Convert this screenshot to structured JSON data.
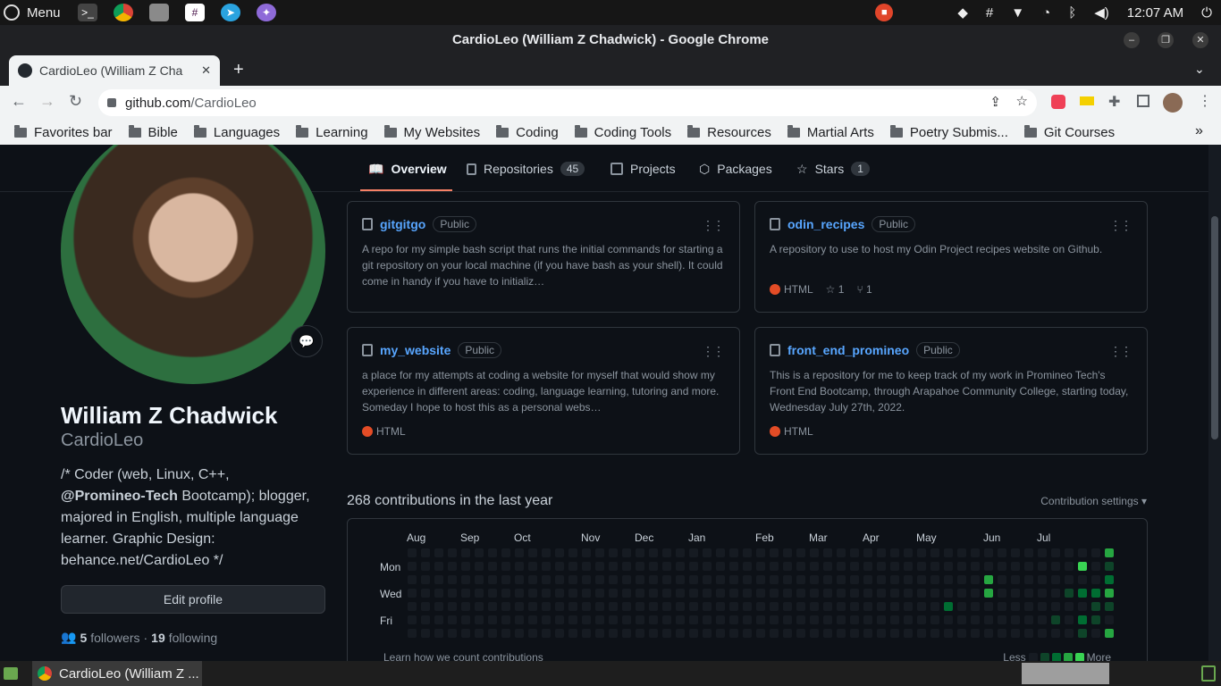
{
  "os_panel": {
    "menu_label": "Menu",
    "clock": "12:07 AM"
  },
  "window": {
    "title": "CardioLeo (William Z Chadwick) - Google Chrome"
  },
  "tab": {
    "title": "CardioLeo (William Z Cha"
  },
  "omnibox": {
    "host": "github.com",
    "path": "/CardioLeo"
  },
  "bookmarks": [
    "Favorites bar",
    "Bible",
    "Languages",
    "Learning",
    "My Websites",
    "Coding",
    "Coding Tools",
    "Resources",
    "Martial Arts",
    "Poetry Submis...",
    "Git Courses"
  ],
  "gh_tabs": {
    "overview": "Overview",
    "repositories": "Repositories",
    "repositories_count": "45",
    "projects": "Projects",
    "packages": "Packages",
    "stars": "Stars",
    "stars_count": "1"
  },
  "profile": {
    "name": "William Z Chadwick",
    "login": "CardioLeo",
    "bio_1": "/* Coder (web, Linux, C++,",
    "bio_org": "@Promineo-Tech",
    "bio_2": " Bootcamp); blogger, majored in English, multiple language learner. Graphic Design: behance.net/CardioLeo */",
    "edit_label": "Edit profile",
    "followers": "5",
    "followers_label": "followers",
    "dot": "·",
    "following": "19",
    "following_label": "following"
  },
  "repos": [
    {
      "name": "gitgitgo",
      "visibility": "Public",
      "description": "A repo for my simple bash script that runs the initial commands for starting a git repository on your local machine (if you have bash as your shell). It could come in handy if you have to initializ…"
    },
    {
      "name": "odin_recipes",
      "visibility": "Public",
      "description": "A repository to use to host my Odin Project recipes website on Github.",
      "language": "HTML",
      "stars": "1",
      "forks": "1"
    },
    {
      "name": "my_website",
      "visibility": "Public",
      "description": "a place for my attempts at coding a website for myself that would show my experience in different areas: coding, language learning, tutoring and more. Someday I hope to host this as a personal webs…",
      "language": "HTML"
    },
    {
      "name": "front_end_promineo",
      "visibility": "Public",
      "description": "This is a repository for me to keep track of my work in Promineo Tech's Front End Bootcamp, through Arapahoe Community College, starting today, Wednesday July 27th, 2022.",
      "language": "HTML"
    }
  ],
  "contributions": {
    "title": "268 contributions in the last year",
    "settings": "Contribution settings ▾",
    "months": [
      "Aug",
      "Sep",
      "Oct",
      "Nov",
      "Dec",
      "Jan",
      "Feb",
      "Mar",
      "Apr",
      "May",
      "Jun",
      "Jul"
    ],
    "days": [
      "Mon",
      "Wed",
      "Fri"
    ],
    "learn": "Learn how we count contributions",
    "less": "Less",
    "more": "More",
    "colors": [
      "#161b22",
      "#0e4429",
      "#006d32",
      "#26a641",
      "#39d353"
    ]
  },
  "taskbar": {
    "item": "CardioLeo (William Z ..."
  }
}
